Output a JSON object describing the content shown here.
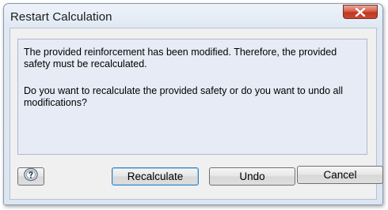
{
  "dialog": {
    "title": "Restart Calculation",
    "message_line1": "The provided reinforcement has been modified. Therefore, the provided safety must be recalculated.",
    "message_line2": "Do you want to recalculate the provided safety or do you want to undo all modifications?"
  },
  "buttons": {
    "recalculate": "Recalculate",
    "undo": "Undo",
    "cancel": "Cancel"
  },
  "icons": {
    "close": "close-icon",
    "help": "help-icon"
  },
  "colors": {
    "close_button": "#c94a33",
    "message_panel": "#e7ebf6",
    "default_button_border": "#3c7fb1"
  }
}
